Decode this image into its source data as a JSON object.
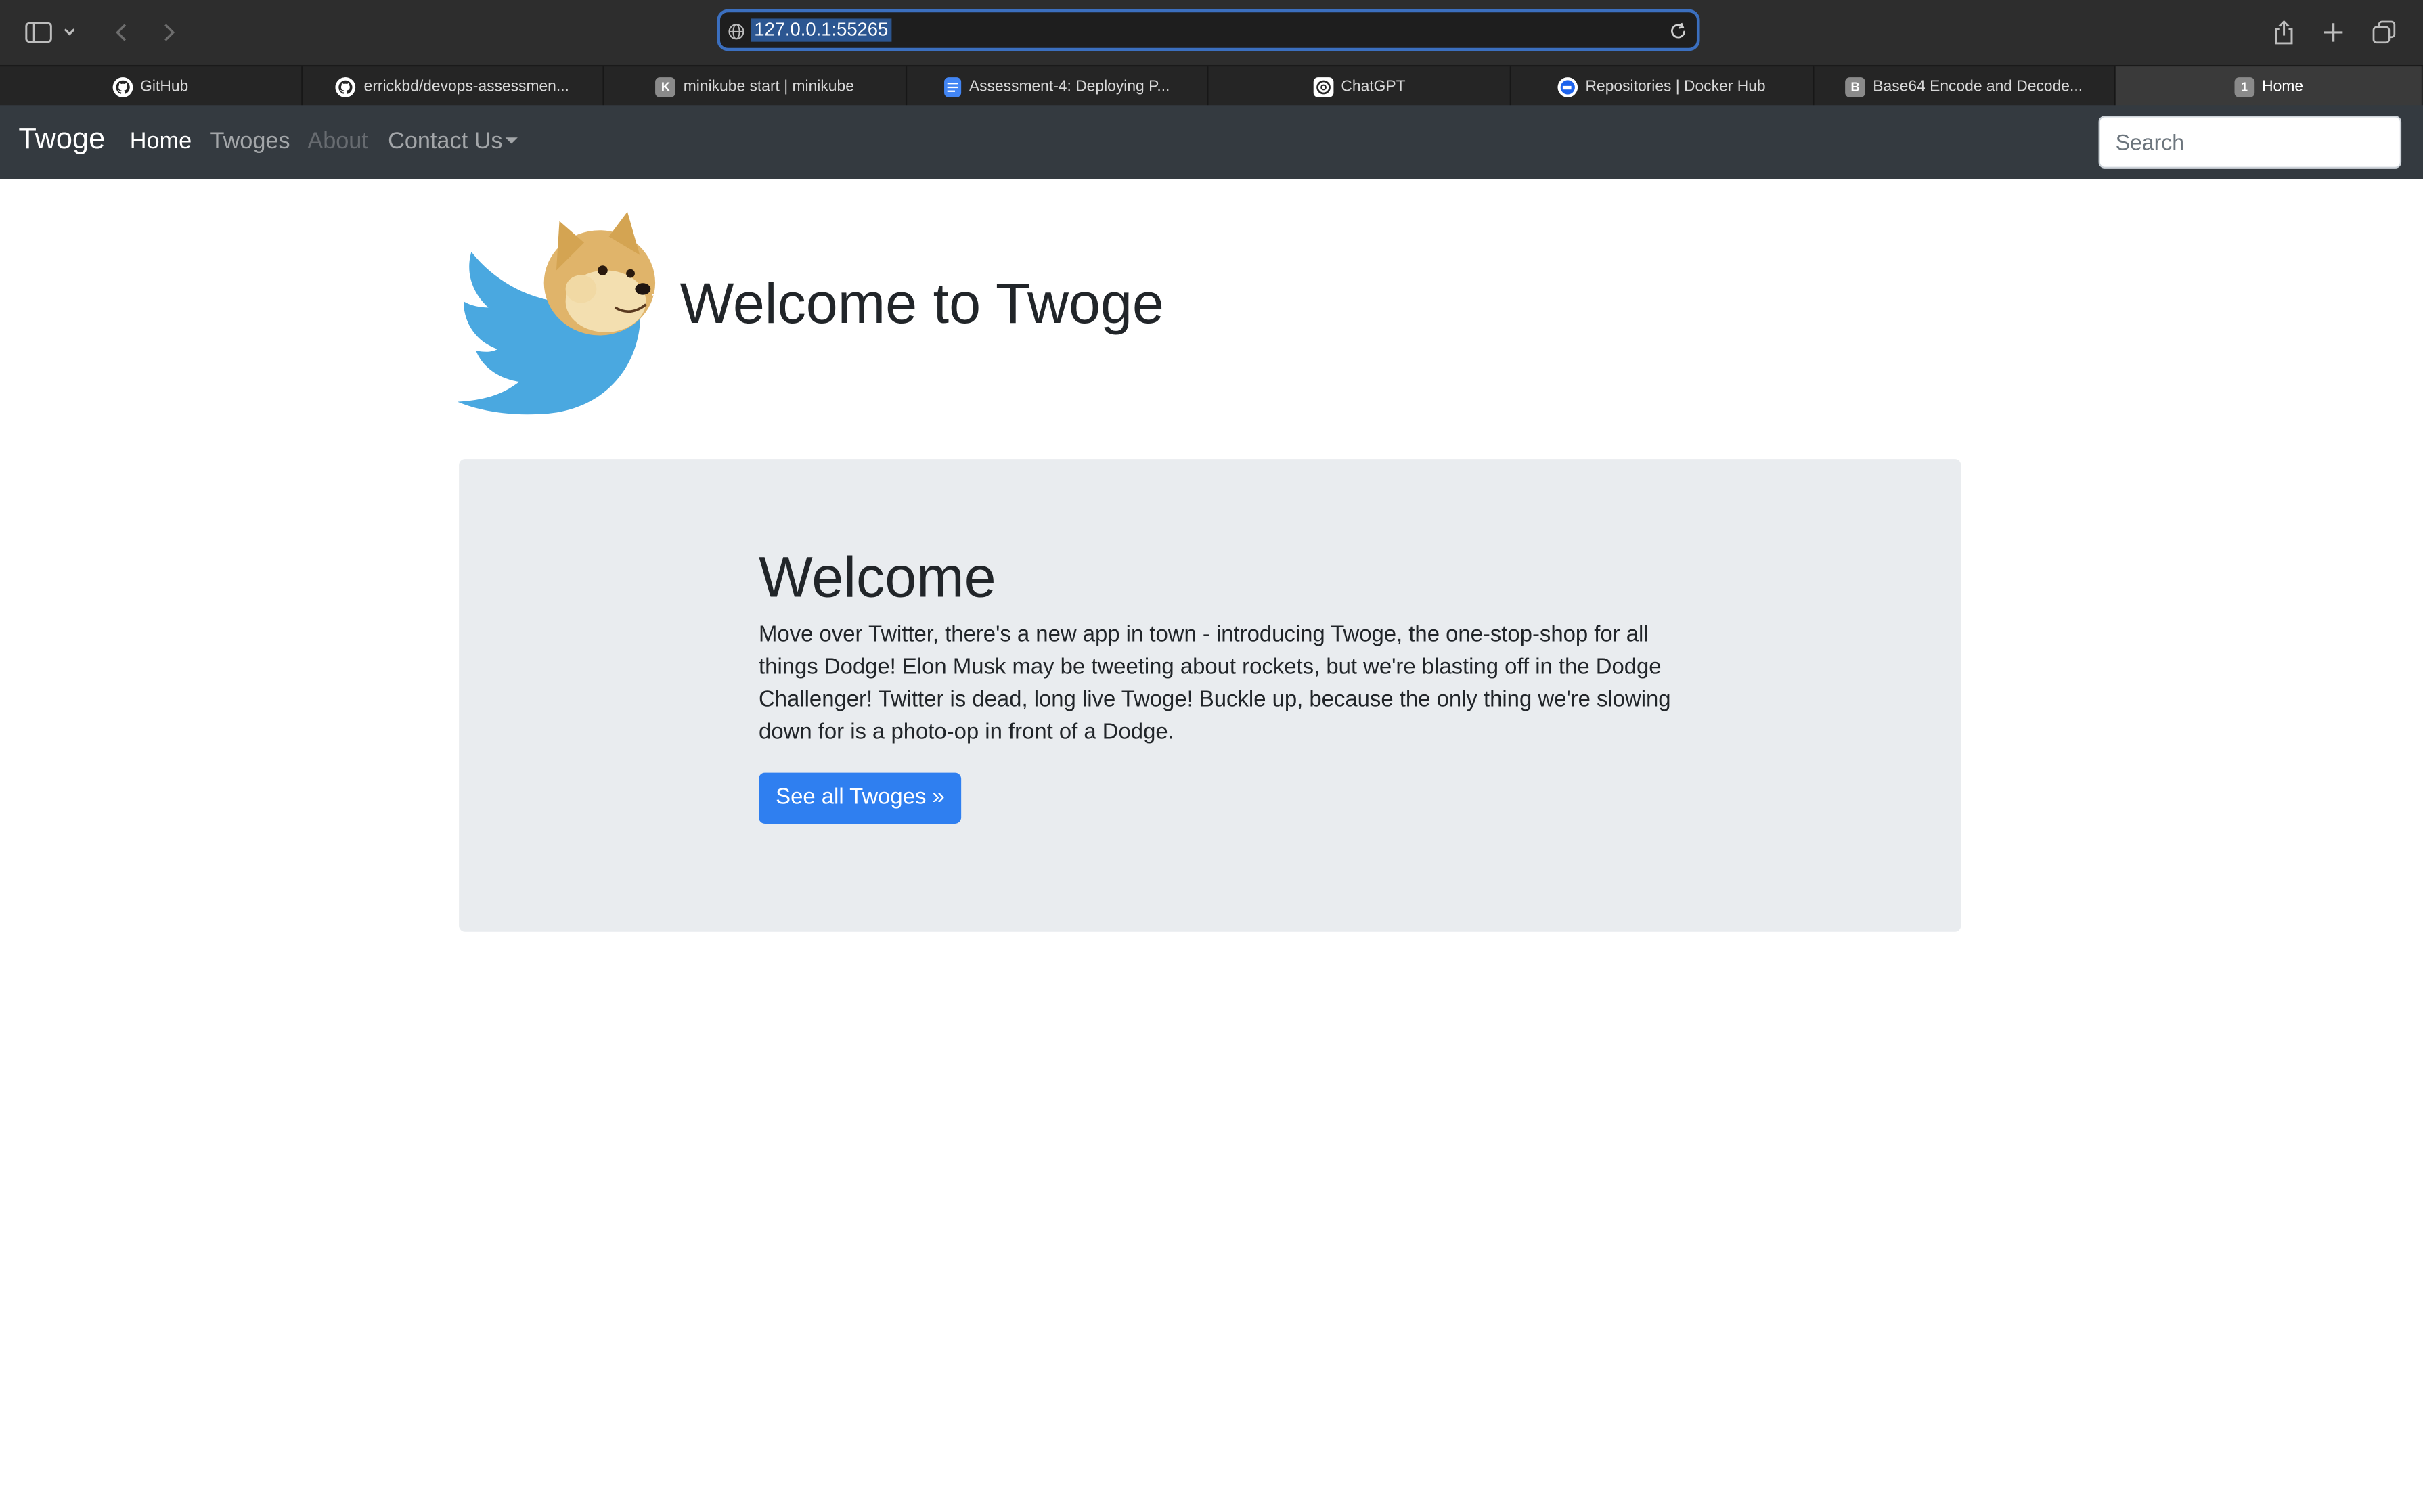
{
  "browser": {
    "url": "127.0.0.1:55265",
    "tabs": [
      {
        "label": "GitHub",
        "icon": "github-icon"
      },
      {
        "label": "errickbd/devops-assessmen...",
        "icon": "github-icon"
      },
      {
        "label": "minikube start | minikube",
        "icon": "k-letter-icon",
        "icon_letter": "K"
      },
      {
        "label": "Assessment-4: Deploying P...",
        "icon": "google-docs-icon"
      },
      {
        "label": "ChatGPT",
        "icon": "openai-icon"
      },
      {
        "label": "Repositories | Docker Hub",
        "icon": "docker-icon"
      },
      {
        "label": "Base64 Encode and Decode...",
        "icon": "b-letter-icon",
        "icon_letter": "B"
      },
      {
        "label": "Home",
        "icon": "1-letter-icon",
        "icon_letter": "1",
        "active": true
      }
    ]
  },
  "navbar": {
    "brand": "Twoge",
    "links": [
      {
        "label": "Home",
        "state": "active"
      },
      {
        "label": "Twoges",
        "state": "normal"
      },
      {
        "label": "About",
        "state": "disabled"
      },
      {
        "label": "Contact Us",
        "state": "dropdown"
      }
    ],
    "search_placeholder": "Search"
  },
  "page": {
    "title": "Welcome to Twoge",
    "jumbotron": {
      "heading": "Welcome",
      "body": "Move over Twitter, there's a new app in town - introducing Twoge, the one-stop-shop for all things Dodge! Elon Musk may be tweeting about rockets, but we're blasting off in the Dodge Challenger! Twitter is dead, long live Twoge! Buckle up, because the only thing we're slowing down for is a photo-op in front of a Dodge.",
      "button": "See all Twoges »"
    }
  },
  "colors": {
    "navbar_bg": "#343a40",
    "jumbotron_bg": "#e9ecef",
    "primary": "#2f7ff0",
    "twitter_blue": "#4aa8e0"
  }
}
